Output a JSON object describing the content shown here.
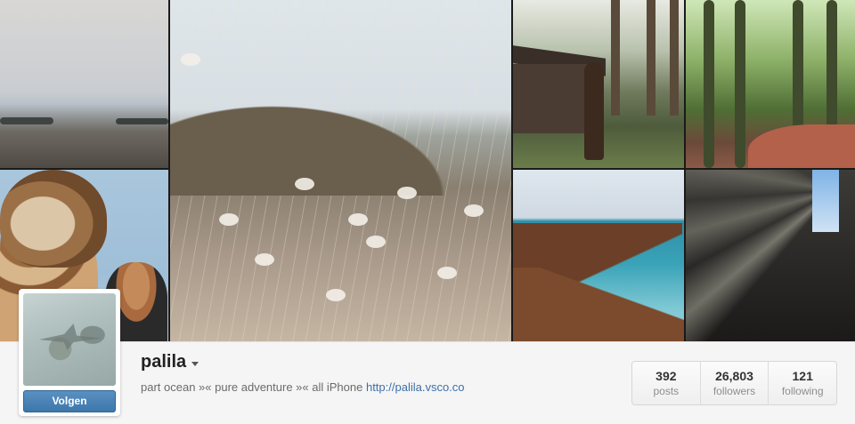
{
  "grid": {
    "tiles": [
      {
        "name": "photo-sea-shore"
      },
      {
        "name": "photo-giraffe-girl"
      },
      {
        "name": "photo-dry-grass"
      },
      {
        "name": "photo-antelope-cabin"
      },
      {
        "name": "photo-forest-path"
      },
      {
        "name": "photo-coast-cliff"
      },
      {
        "name": "photo-sun-rays"
      }
    ]
  },
  "profile": {
    "username": "palila",
    "follow_label": "Volgen",
    "bio_text": "part ocean »« pure adventure »« all iPhone ",
    "bio_link": "http://palila.vsco.co",
    "avatar_icon": "bird-photo"
  },
  "stats": [
    {
      "value": "392",
      "label": "posts"
    },
    {
      "value": "26,803",
      "label": "followers"
    },
    {
      "value": "121",
      "label": "following"
    }
  ],
  "colors": {
    "follow_button": "#3d77ab",
    "link": "#3d6fa8",
    "background": "#f5f5f5"
  }
}
